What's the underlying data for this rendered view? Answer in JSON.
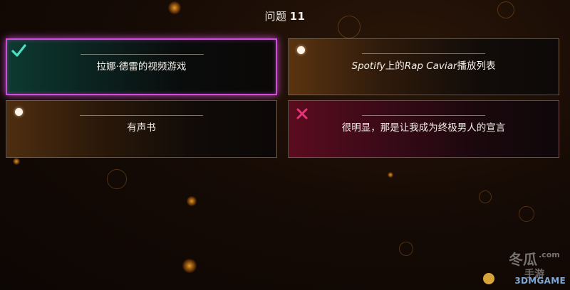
{
  "header": {
    "title_prefix": "问题",
    "question_number": "11"
  },
  "answers": [
    {
      "label": "拉娜·德雷的视频游戏",
      "state": "correct",
      "marker_icon": "checkmark-icon"
    },
    {
      "label_parts": [
        "Spotify",
        "上的",
        "Rap Caviar",
        "播放列表"
      ],
      "state": "unselected",
      "marker_icon": "radio-dot-icon"
    },
    {
      "label": "有声书",
      "state": "unselected",
      "marker_icon": "radio-dot-icon"
    },
    {
      "label": "很明显，那是让我成为终极男人的宣言",
      "state": "wrong",
      "marker_icon": "cross-icon"
    }
  ],
  "colors": {
    "correct_accent": "#4de0c4",
    "selected_border": "#d14ed8",
    "wrong_accent": "#e8357a"
  },
  "watermark": {
    "logo_text": "3DMGAME",
    "brand": "冬瓜手游",
    "domain": ".com"
  }
}
